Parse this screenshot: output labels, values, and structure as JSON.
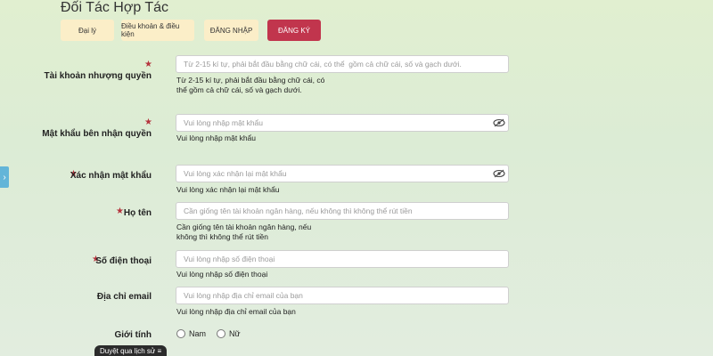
{
  "page": {
    "title": "Đối Tác Hợp Tác"
  },
  "tabs": [
    {
      "label": "Đại lý"
    },
    {
      "label": "Điều khoản & điều kiện"
    },
    {
      "label": "ĐĂNG NHẬP"
    },
    {
      "label": "ĐĂNG KÝ"
    }
  ],
  "form": {
    "account": {
      "label": "Tài khoản nhượng quyền",
      "placeholder": "Từ 2-15 kí tự, phải bắt đầu bằng chữ cái, có thể  gồm cả chữ cái, số và gạch dưới.",
      "hint": "Từ 2-15 kí tự, phải bắt đầu bằng chữ cái, có thể gồm cả chữ cái, số và gạch dưới."
    },
    "password": {
      "label": "Mật khẩu bên nhận quyền",
      "placeholder": "Vui lòng nhập mật khẩu",
      "hint": "Vui lòng nhập mật khẩu"
    },
    "confirm": {
      "label": "Xác nhận mật khẩu",
      "placeholder": "Vui lòng xác nhận lại mật khẩu",
      "hint": "Vui lòng xác nhận lại mật khẩu"
    },
    "fullname": {
      "label": "Họ tên",
      "placeholder": "Cần giống tên tài khoản ngân hàng, nếu không thì không thể rút tiền",
      "hint": "Cần giống tên tài khoản ngân hàng, nếu không thì không thể rút tiền"
    },
    "phone": {
      "label": "Số điện thoại",
      "placeholder": "Vui lòng nhập số điện thoại",
      "hint": "Vui lòng nhập số điện thoại"
    },
    "email": {
      "label": "Địa chỉ email",
      "placeholder": "Vui lòng nhập địa chỉ email của bạn",
      "hint": "Vui lòng nhập địa chỉ email của bạn"
    },
    "gender": {
      "label": "Giới tính",
      "options": [
        "Nam",
        "Nữ"
      ]
    }
  },
  "history_tab": {
    "label": "Duyệt qua lịch sử ≡"
  },
  "side_toggle": {
    "icon": "›"
  },
  "colors": {
    "accent": "#c1354d",
    "tab_bg": "#fbeec8",
    "star": "#b5343d"
  }
}
